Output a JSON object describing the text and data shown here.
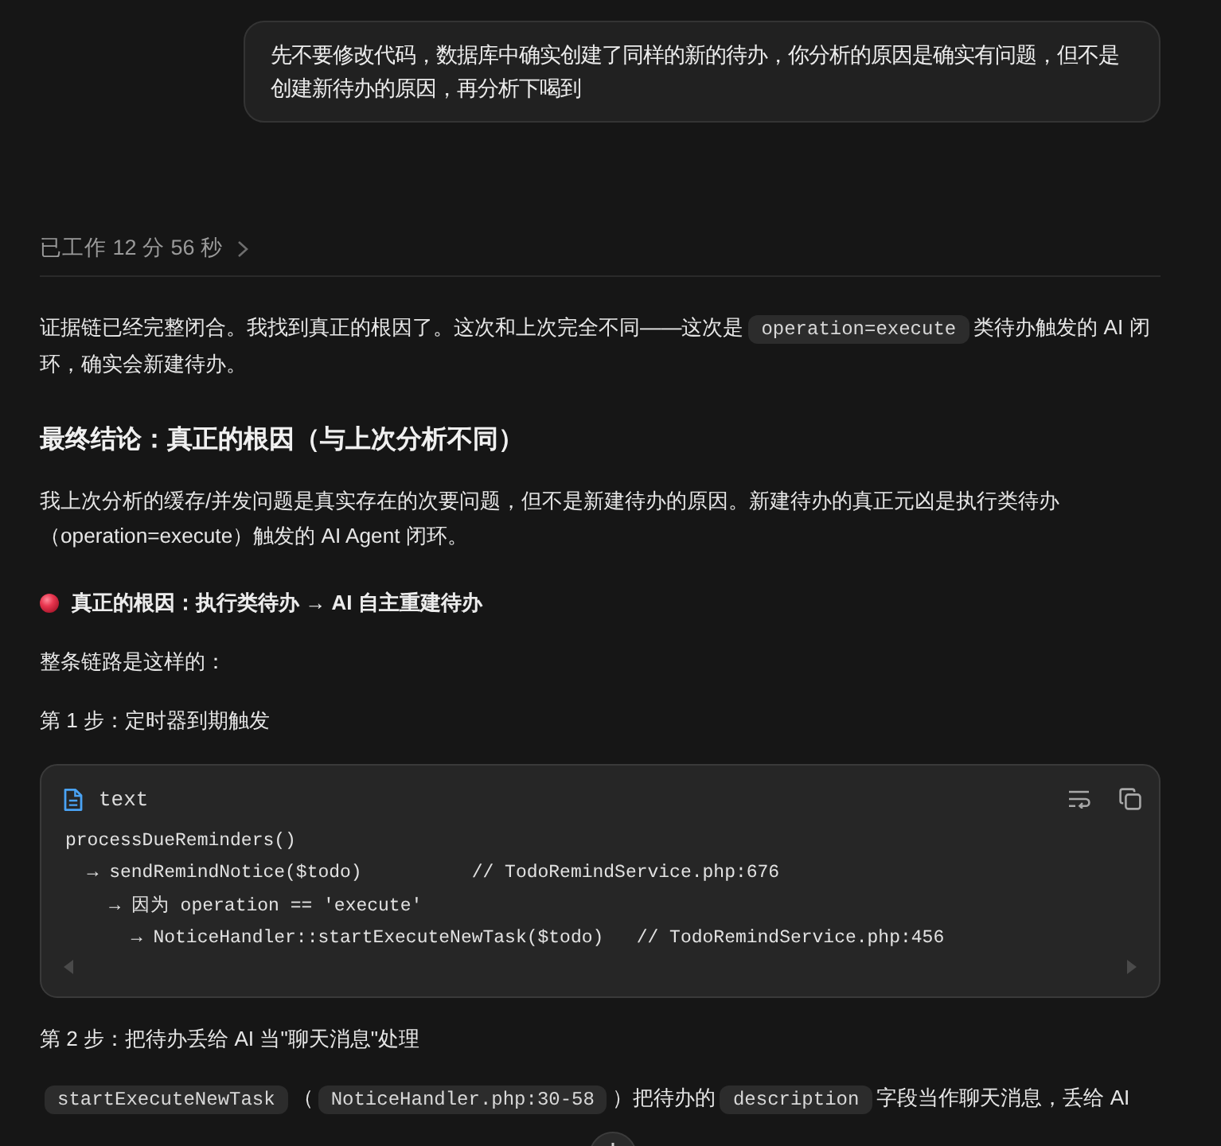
{
  "user_message": {
    "text": "先不要修改代码，数据库中确实创建了同样的新的待办，你分析的原因是确实有问题，但不是创建新待办的原因，再分析下喝到"
  },
  "work_status": {
    "label": "已工作 12 分 56 秒",
    "expanded": false
  },
  "blocks": [
    {
      "kind": "paragraph",
      "segments": [
        {
          "kind": "text",
          "text": "证据链已经完整闭合。我找到真正的根因了。这次和上次完全不同——这次是"
        },
        {
          "kind": "code",
          "text": "operation=execute"
        },
        {
          "kind": "text",
          "text": "类待办触发的 AI 闭环，确实会新建待办。"
        }
      ]
    },
    {
      "kind": "heading",
      "text": "最终结论：真正的根因（与上次分析不同）"
    },
    {
      "kind": "paragraph",
      "segments": [
        {
          "kind": "text",
          "text": "我上次分析的缓存/并发问题是真实存在的次要问题，但不是新建待办的原因。新建待办的真正元凶是执行类待办（operation=execute）触发的 AI Agent 闭环。"
        }
      ]
    },
    {
      "kind": "callout",
      "text": "真正的根因：执行类待办 → AI 自主重建待办"
    },
    {
      "kind": "paragraph",
      "segments": [
        {
          "kind": "text",
          "text": "整条链路是这样的："
        }
      ]
    },
    {
      "kind": "step",
      "text": "第 1 步：定时器到期触发"
    },
    {
      "kind": "code",
      "language": "text",
      "lines": [
        "processDueReminders()",
        "  → sendRemindNotice($todo)          // TodoRemindService.php:676",
        "    → 因为 operation == 'execute'",
        "      → NoticeHandler::startExecuteNewTask($todo)   // TodoRemindService.php:456"
      ]
    },
    {
      "kind": "step",
      "text": "第 2 步：把待办丢给 AI 当\"聊天消息\"处理"
    },
    {
      "kind": "paragraph",
      "segments": [
        {
          "kind": "code",
          "text": "startExecuteNewTask"
        },
        {
          "kind": "text",
          "text": "（"
        },
        {
          "kind": "code",
          "text": "NoticeHandler.php:30-58"
        },
        {
          "kind": "text",
          "text": "）把待办的"
        },
        {
          "kind": "code",
          "text": "description"
        },
        {
          "kind": "text",
          "text": "字段当作聊天消息，丢给 AI"
        }
      ]
    }
  ]
}
